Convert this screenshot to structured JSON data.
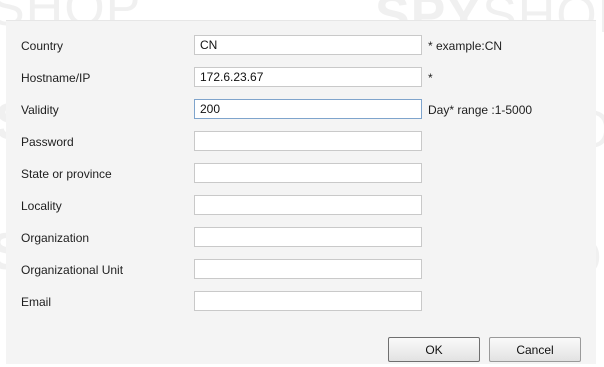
{
  "form": {
    "fields": [
      {
        "label": "Country",
        "value": "CN",
        "hint": "* example:CN"
      },
      {
        "label": "Hostname/IP",
        "value": "172.6.23.67",
        "hint": "*"
      },
      {
        "label": "Validity",
        "value": "200",
        "hint": "Day*  range :1-5000"
      },
      {
        "label": "Password",
        "value": "",
        "hint": ""
      },
      {
        "label": "State or province",
        "value": "",
        "hint": ""
      },
      {
        "label": "Locality",
        "value": "",
        "hint": ""
      },
      {
        "label": "Organization",
        "value": "",
        "hint": ""
      },
      {
        "label": "Organizational Unit",
        "value": "",
        "hint": ""
      },
      {
        "label": "Email",
        "value": "",
        "hint": ""
      }
    ]
  },
  "buttons": {
    "ok_label": "OK",
    "cancel_label": "Cancel"
  },
  "colors": {
    "panel_bg": "#f4f4f4",
    "focus_border": "#7fa4cc"
  }
}
